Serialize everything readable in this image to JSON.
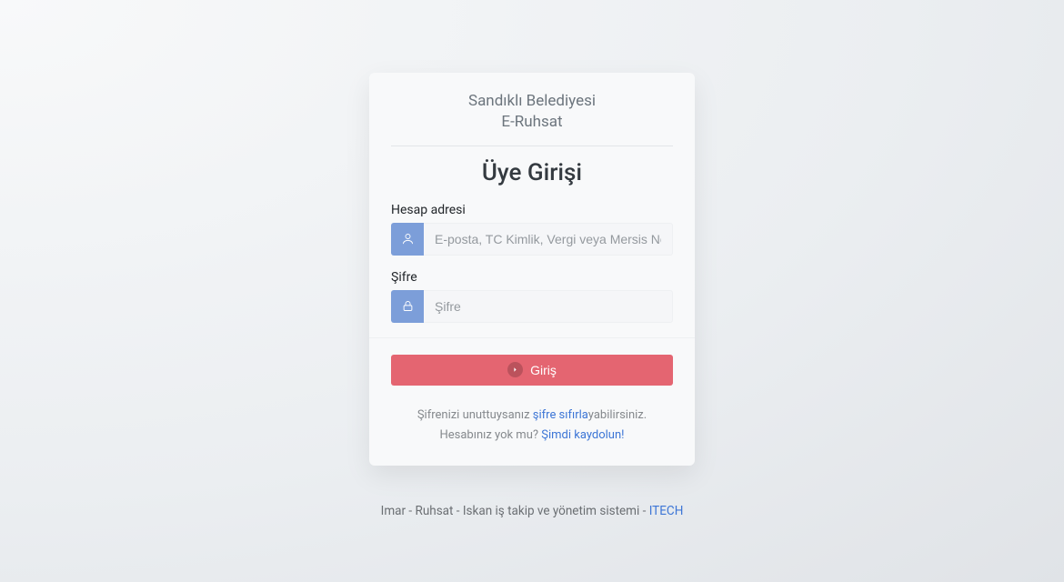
{
  "brand": {
    "line1": "Sandıklı Belediyesi",
    "line2": "E-Ruhsat"
  },
  "heading": "Üye Girişi",
  "account": {
    "label": "Hesap adresi",
    "placeholder": "E-posta, TC Kimlik, Vergi veya Mersis No"
  },
  "password": {
    "label": "Şifre",
    "placeholder": "Şifre"
  },
  "submit": "Giriş",
  "helper": {
    "forgot_pre": "Şifrenizi unuttuysanız ",
    "forgot_link": "şifre sıfırla",
    "forgot_post": "yabilirsiniz.",
    "signup_pre": "Hesabınız yok mu? ",
    "signup_link": "Şimdi kaydolun!"
  },
  "footer": {
    "text": "Imar - Ruhsat - Iskan iş takip ve yönetim sistemi - ",
    "link": "ITECH"
  }
}
